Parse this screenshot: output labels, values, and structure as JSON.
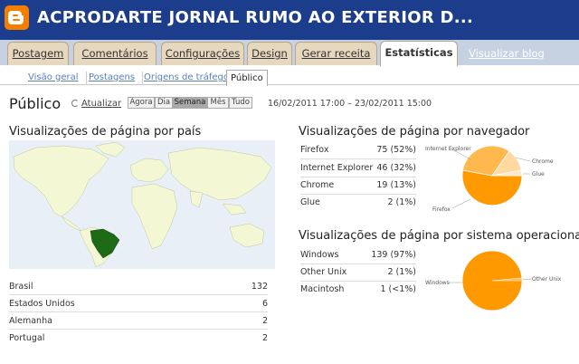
{
  "header": {
    "blog_title": "ACPRODARTE JORNAL RUMO AO EXTERIOR D..."
  },
  "tabs": [
    {
      "label": "Postagem"
    },
    {
      "label": "Comentários"
    },
    {
      "label": "Configurações"
    },
    {
      "label": "Design"
    },
    {
      "label": "Gerar receita"
    },
    {
      "label": "Estatísticas",
      "active": true
    }
  ],
  "view_blog_label": "Visualizar blog",
  "subtabs": [
    {
      "label": "Visão geral"
    },
    {
      "label": "Postagens"
    },
    {
      "label": "Origens de tráfego"
    },
    {
      "label": "Público",
      "active": true
    }
  ],
  "page": {
    "title": "Público",
    "refresh_label": "Atualizar",
    "range_buttons": [
      "Agora",
      "Dia",
      "Semana",
      "Mês",
      "Tudo"
    ],
    "range_active": "Semana",
    "date_range": "16/02/2011 17:00 – 23/02/2011 15:00"
  },
  "country": {
    "title": "Visualizações de página por país",
    "rows": [
      {
        "label": "Brasil",
        "value": "132"
      },
      {
        "label": "Estados Unidos",
        "value": "6"
      },
      {
        "label": "Alemanha",
        "value": "2"
      },
      {
        "label": "Portugal",
        "value": "2"
      }
    ]
  },
  "browser": {
    "title": "Visualizações de página por navegador",
    "rows": [
      {
        "label": "Firefox",
        "value": "75 (52%)"
      },
      {
        "label": "Internet Explorer",
        "value": "46 (32%)"
      },
      {
        "label": "Chrome",
        "value": "19 (13%)"
      },
      {
        "label": "Glue",
        "value": "2 (1%)"
      }
    ],
    "pie_labels": {
      "ie": "Internet Explorer",
      "chrome": "Chrome",
      "glue": "Glue",
      "firefox": "Firefox"
    }
  },
  "os": {
    "title": "Visualizações de página por sistema operacional",
    "rows": [
      {
        "label": "Windows",
        "value": "139 (97%)"
      },
      {
        "label": "Other Unix",
        "value": "2 (1%)"
      },
      {
        "label": "Macintosh",
        "value": "1 (<1%)"
      }
    ],
    "pie_labels": {
      "windows": "Windows",
      "other": "Other Unix"
    }
  },
  "colors": {
    "topbar": "#1c3c8c",
    "logo": "#f57d00",
    "pie_main": "#ff9900",
    "pie_2": "#ffb84d",
    "pie_3": "#ffd9a0",
    "map_land": "#f4f7d4",
    "map_highlight": "#1d6b16"
  }
}
